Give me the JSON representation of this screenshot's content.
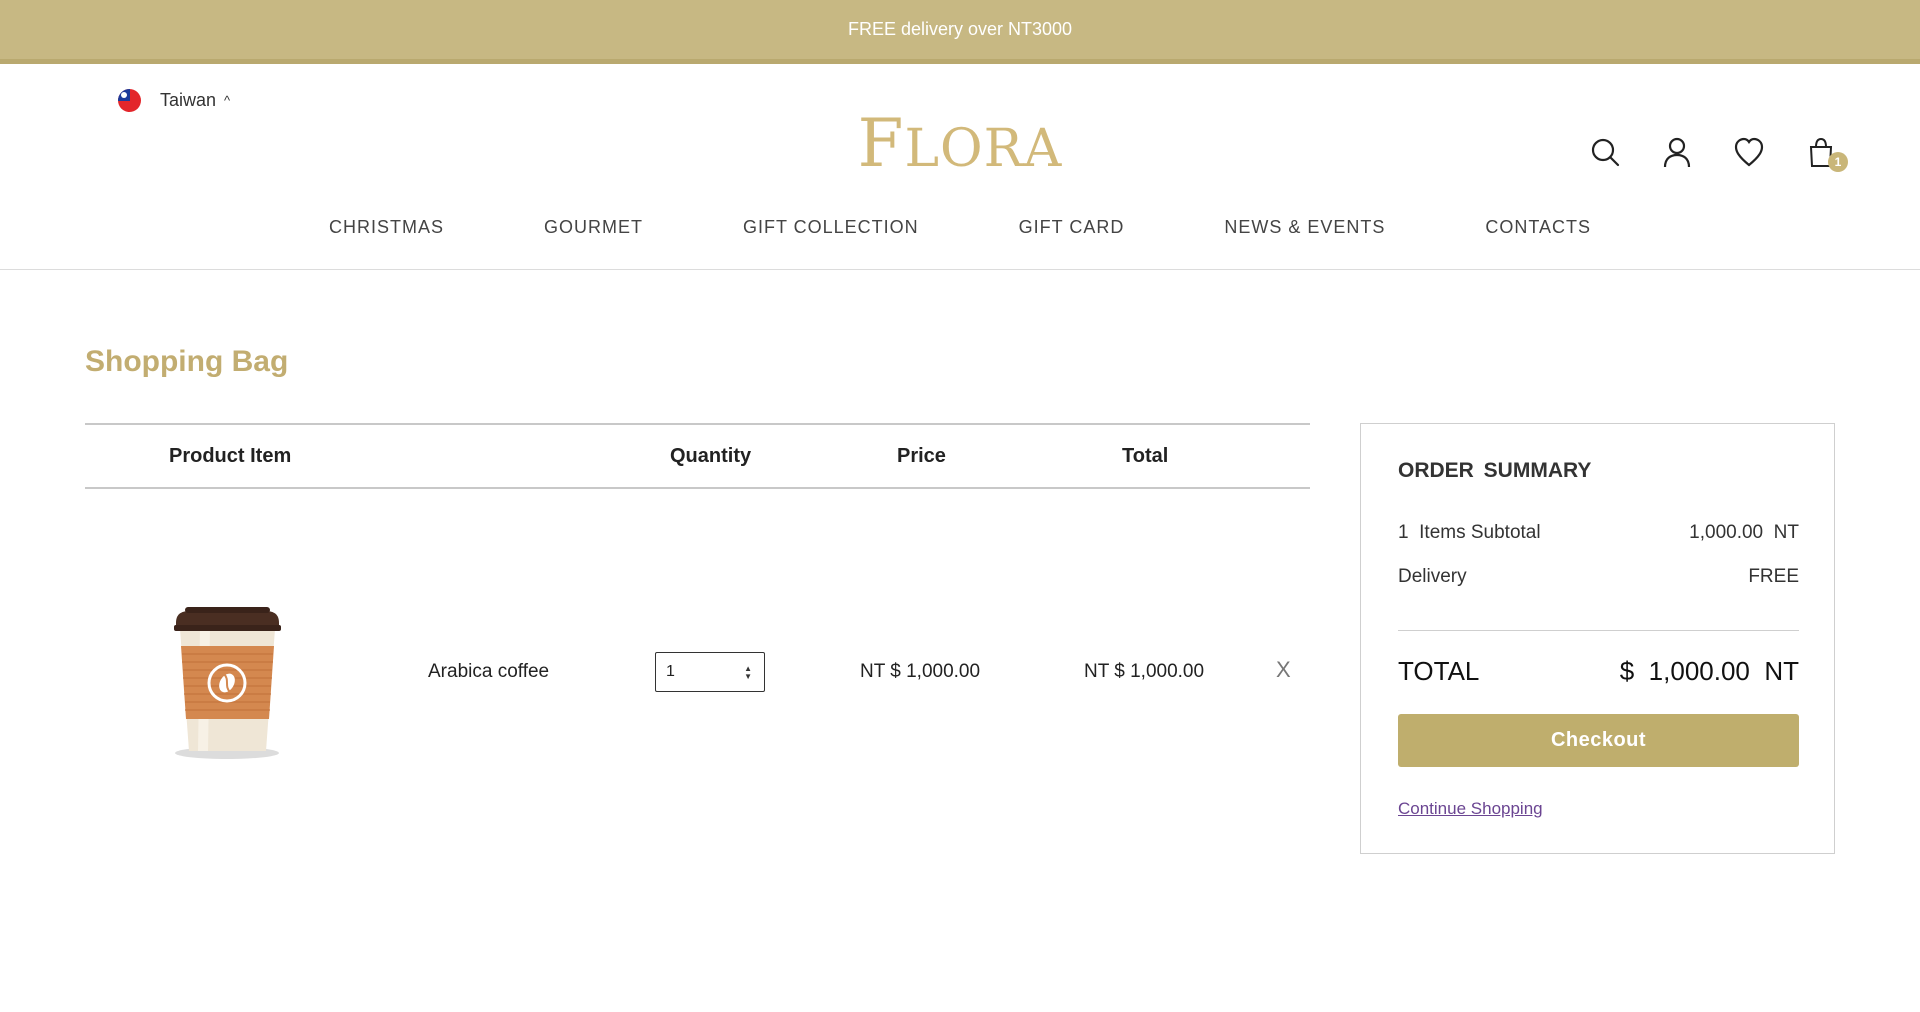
{
  "promo": {
    "text": "FREE delivery over NT3000"
  },
  "header": {
    "region": {
      "label": "Taiwan",
      "caret": "^"
    },
    "logo": {
      "first": "F",
      "rest": "LORA"
    },
    "icons": [
      "search-icon",
      "user-icon",
      "heart-icon",
      "shopping-bag-icon"
    ],
    "bag_count": "1"
  },
  "nav": {
    "items": [
      {
        "label": "CHRISTMAS"
      },
      {
        "label": "GOURMET"
      },
      {
        "label": "GIFT COLLECTION"
      },
      {
        "label": "GIFT CARD"
      },
      {
        "label": "NEWS & EVENTS"
      },
      {
        "label": "CONTACTS"
      }
    ]
  },
  "page": {
    "title": "Shopping Bag"
  },
  "cart": {
    "headers": {
      "product": "Product Item",
      "quantity": "Quantity",
      "price": "Price",
      "total": "Total"
    },
    "items": [
      {
        "name": "Arabica coffee",
        "quantity": "1",
        "price": "NT $ 1,000.00",
        "total": "NT $ 1,000.00",
        "remove": "X",
        "image": "coffee-cup"
      }
    ]
  },
  "summary": {
    "title": "ORDER SUMMARY",
    "subtitle_count": "1",
    "subtotal_label": "Items Subtotal",
    "subtotal_value": "1,000.00  NT",
    "delivery_label": "Delivery",
    "delivery_value": "FREE",
    "total_label": "TOTAL",
    "total_value": "$  1,000.00  NT",
    "checkout_label": "Checkout",
    "continue_label": "Continue Shopping"
  },
  "colors": {
    "accent": "#bfae6d",
    "promo_bg": "#c7b883",
    "title": "#c2ad71",
    "link": "#6b4592"
  }
}
